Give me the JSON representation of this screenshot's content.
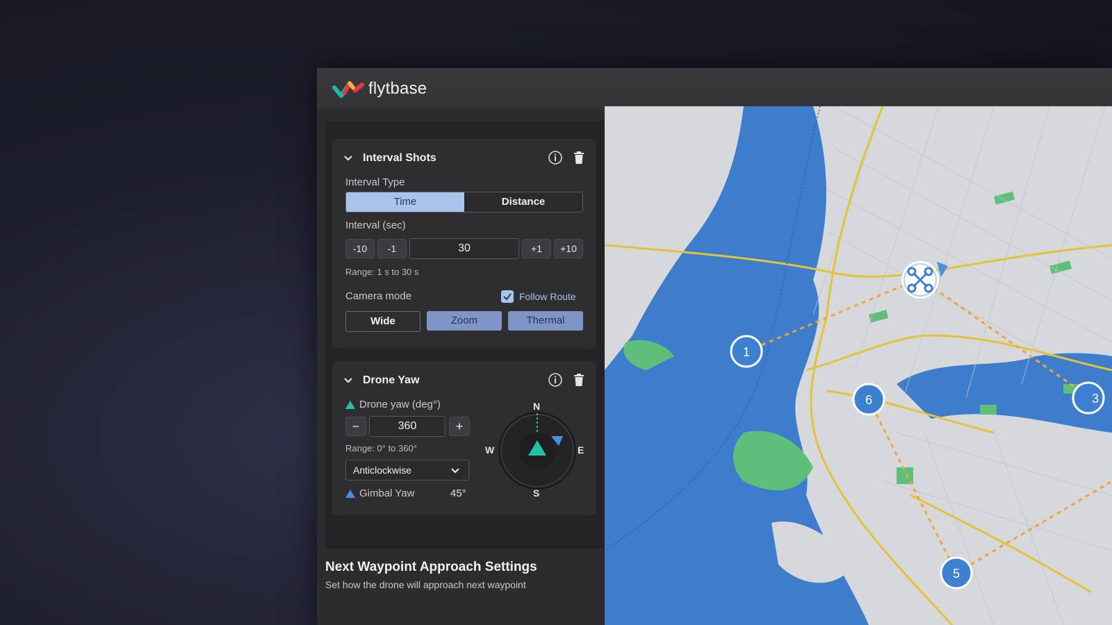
{
  "brand": {
    "name": "flytbase"
  },
  "interval_shots": {
    "title": "Interval Shots",
    "interval_type_label": "Interval Type",
    "type_options": [
      "Time",
      "Distance"
    ],
    "selected_type": "Time",
    "interval_label": "Interval (sec)",
    "steppers": [
      "-10",
      "-1",
      "+1",
      "+10"
    ],
    "interval_value": "30",
    "range_text": "Range: 1 s to 30 s",
    "camera_mode_label": "Camera mode",
    "follow_route_label": "Follow Route",
    "follow_route_checked": true,
    "camera_modes": [
      "Wide",
      "Zoom",
      "Thermal"
    ]
  },
  "drone_yaw": {
    "title": "Drone Yaw",
    "yaw_label": "Drone yaw (deg°)",
    "yaw_value": "360",
    "minus": "−",
    "plus": "+",
    "range_text": "Range: 0° to 360°",
    "direction": "Anticlockwise",
    "gimbal_label": "Gimbal Yaw",
    "gimbal_value": "45°",
    "compass": {
      "n": "N",
      "s": "S",
      "e": "E",
      "w": "W"
    }
  },
  "next_waypoint": {
    "title": "Next Waypoint Approach Settings",
    "subtitle": "Set how the drone will approach next waypoint"
  },
  "map": {
    "waypoints": [
      "1",
      "6",
      "5",
      "3"
    ],
    "colors": {
      "water": "#3e7dcb",
      "land": "#d6d8dc",
      "park": "#5fbf7a",
      "road": "#e3c33a",
      "route": "#f0a43a",
      "marker": "#3d7fd1"
    }
  },
  "colors": {
    "selected_segment": "#a9c3ea",
    "mode_active": "#7f95c8"
  }
}
